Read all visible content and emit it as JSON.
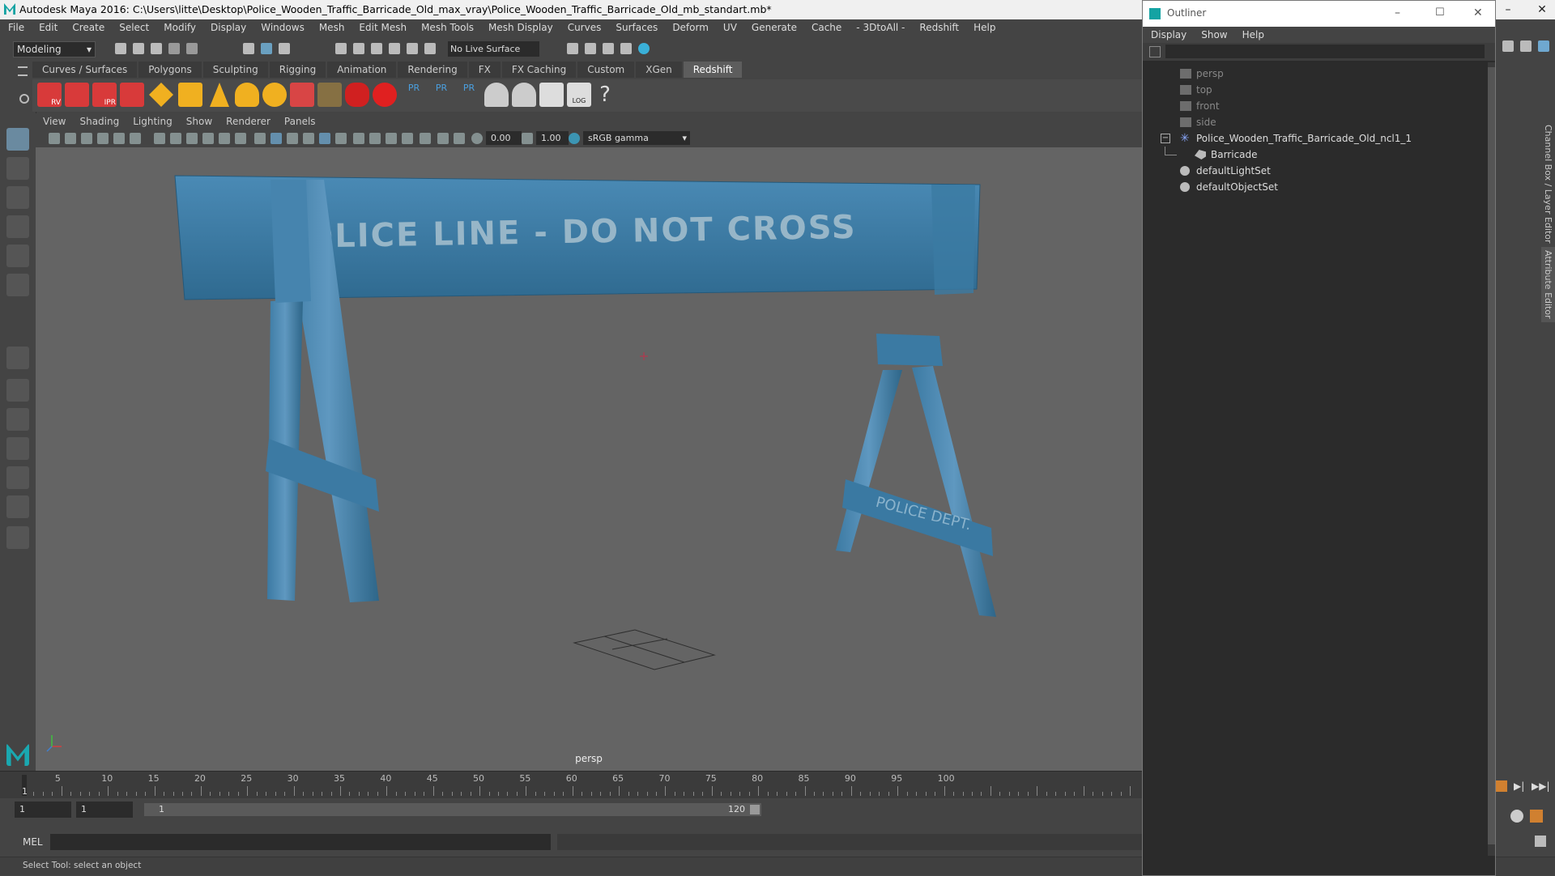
{
  "window": {
    "title": "Autodesk Maya 2016: C:\\Users\\litte\\Desktop\\Police_Wooden_Traffic_Barricade_Old_max_vray\\Police_Wooden_Traffic_Barricade_Old_mb_standart.mb*",
    "minimize": "–",
    "close": "✕"
  },
  "menubar": [
    "File",
    "Edit",
    "Create",
    "Select",
    "Modify",
    "Display",
    "Windows",
    "Mesh",
    "Edit Mesh",
    "Mesh Tools",
    "Mesh Display",
    "Curves",
    "Surfaces",
    "Deform",
    "UV",
    "Generate",
    "Cache",
    "- 3DtoAll -",
    "Redshift",
    "Help"
  ],
  "statusline": {
    "mode": "Modeling",
    "live_surface": "No Live Surface"
  },
  "shelf_tabs": [
    {
      "label": "Curves / Surfaces"
    },
    {
      "label": "Polygons"
    },
    {
      "label": "Sculpting"
    },
    {
      "label": "Rigging"
    },
    {
      "label": "Animation"
    },
    {
      "label": "Rendering"
    },
    {
      "label": "FX"
    },
    {
      "label": "FX Caching"
    },
    {
      "label": "Custom"
    },
    {
      "label": "XGen"
    },
    {
      "label": "Redshift",
      "active": true
    }
  ],
  "shelf_labels": {
    "rv": "RV",
    "ipr": "IPR",
    "pr": "PR",
    "log": "LOG",
    "help": "?"
  },
  "viewport": {
    "menu": [
      "View",
      "Shading",
      "Lighting",
      "Show",
      "Renderer",
      "Panels"
    ],
    "exposure": "0.00",
    "gamma": "1.00",
    "color_space": "sRGB gamma",
    "camera_label": "persp",
    "sign_text": "POLICE LINE - DO NOT CROSS",
    "leg_text": "POLICE DEPT."
  },
  "timeline": {
    "ticks": [
      1,
      5,
      10,
      15,
      20,
      25,
      30,
      35,
      40,
      45,
      50,
      55,
      60,
      65,
      70,
      75,
      80,
      85,
      90,
      95,
      100
    ],
    "current_frame": "1",
    "start": "1",
    "playback_start": "1",
    "range_start": "1",
    "range_end": "120"
  },
  "command_line": {
    "label": "MEL"
  },
  "help_line": "Select Tool: select an object",
  "outliner": {
    "title": "Outliner",
    "menu": [
      "Display",
      "Show",
      "Help"
    ],
    "items": [
      {
        "label": "persp",
        "type": "camera"
      },
      {
        "label": "top",
        "type": "camera"
      },
      {
        "label": "front",
        "type": "camera"
      },
      {
        "label": "side",
        "type": "camera"
      },
      {
        "label": "Police_Wooden_Traffic_Barricade_Old_ncl1_1",
        "type": "group",
        "expanded": true
      },
      {
        "label": "Barricade",
        "type": "mesh"
      },
      {
        "label": "defaultLightSet",
        "type": "set"
      },
      {
        "label": "defaultObjectSet",
        "type": "set"
      }
    ]
  },
  "right_tabs": {
    "channel_box": "Channel Box / Layer Editor",
    "attribute_editor": "Attribute Editor"
  },
  "colors": {
    "barricade_blue": "#3f7fa8",
    "viewport_bg": "#646464",
    "active_tab": "#5d5d5d"
  }
}
